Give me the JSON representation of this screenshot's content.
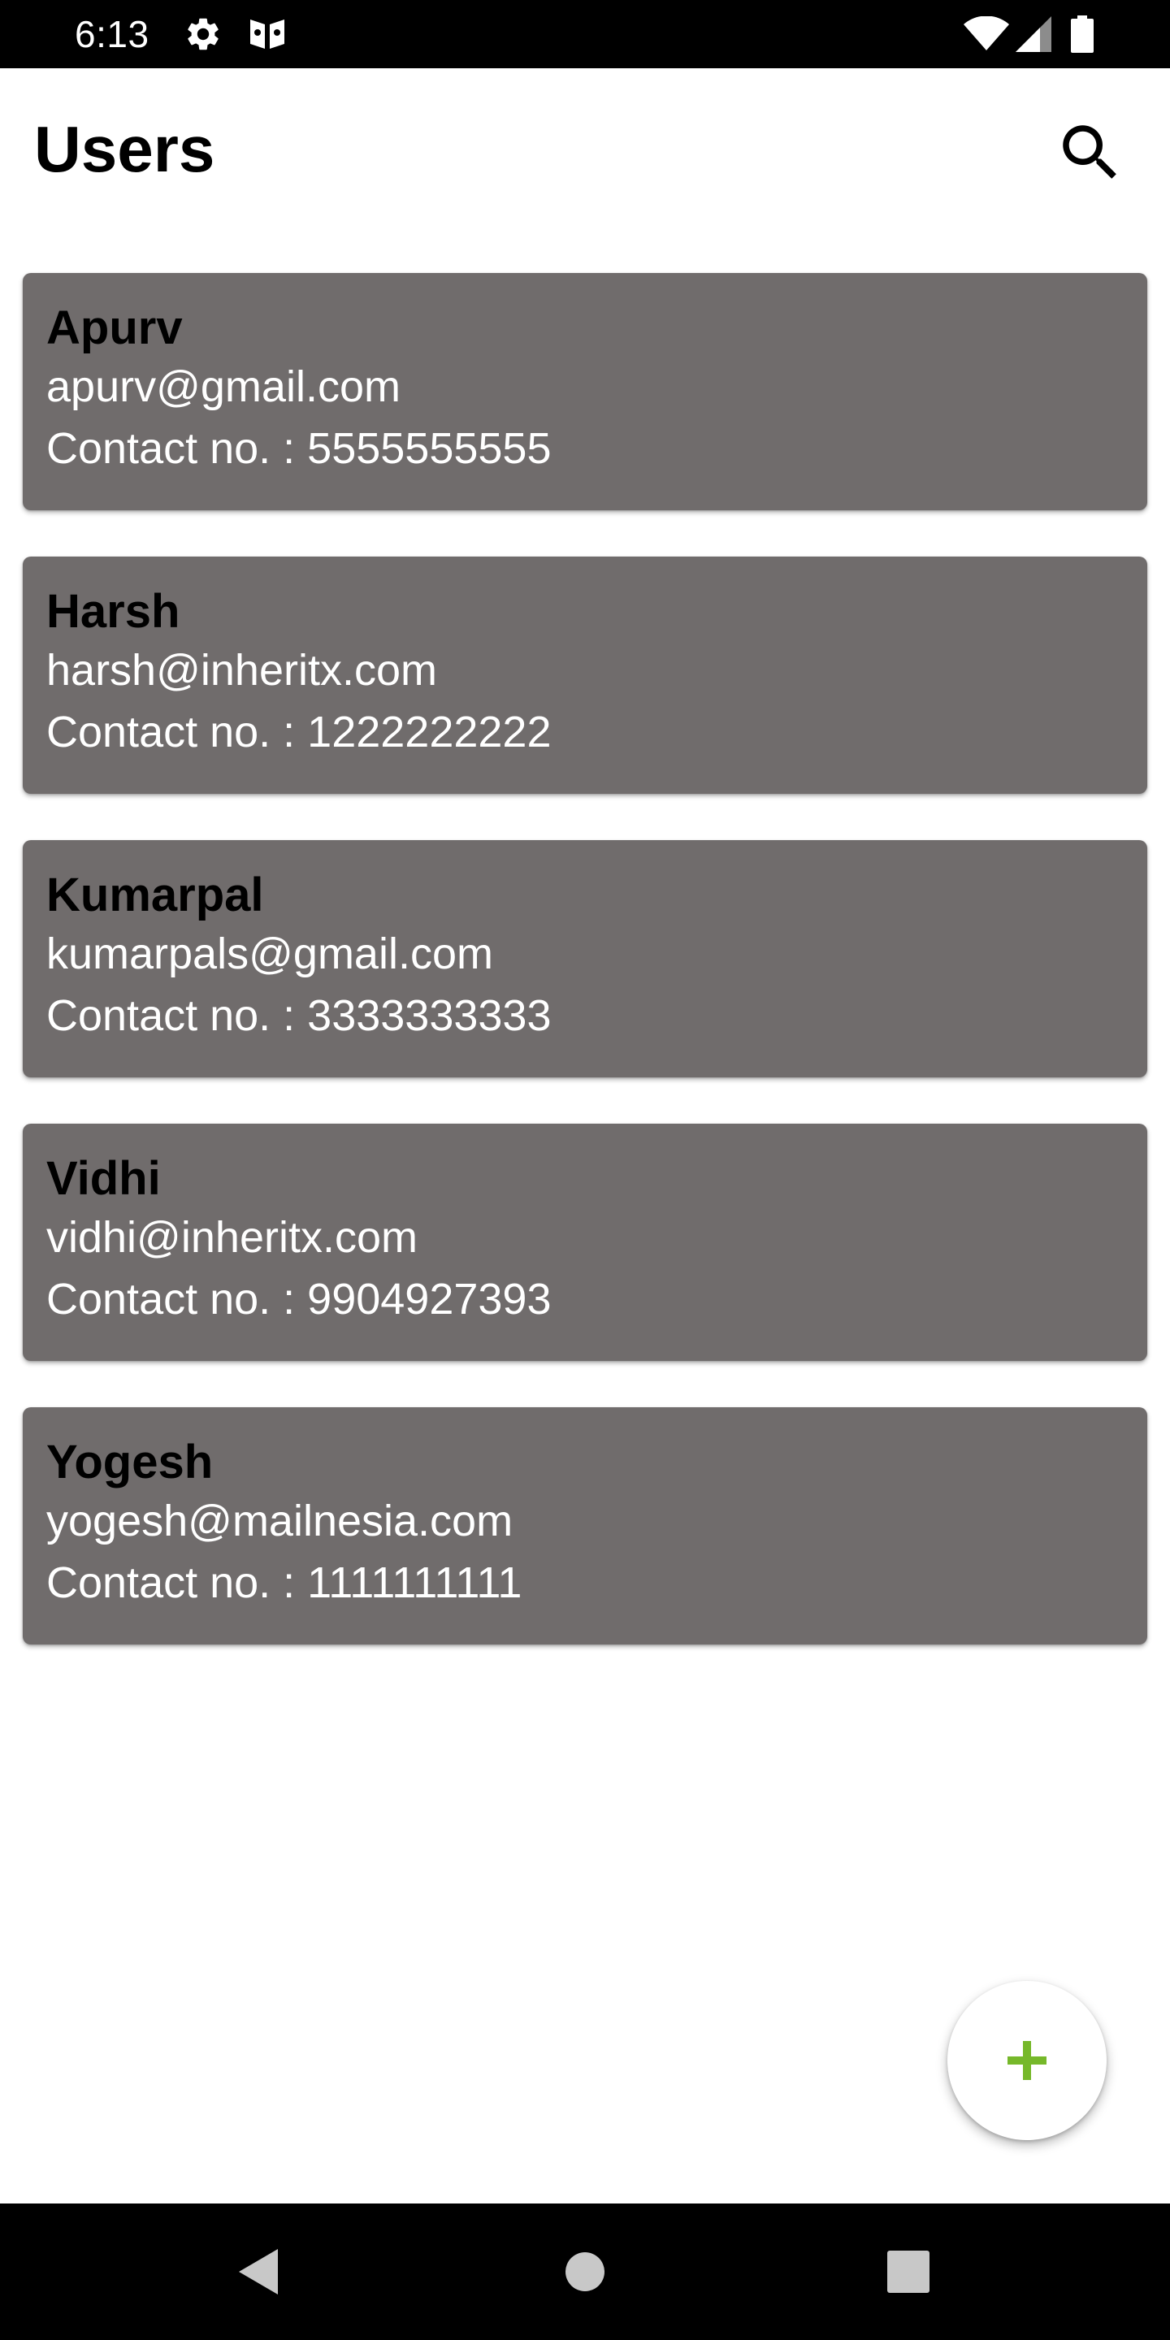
{
  "status_bar": {
    "time": "6:13",
    "icons": [
      "gear-icon",
      "notification-app-icon",
      "wifi-icon",
      "cellular-signal-icon",
      "battery-icon"
    ]
  },
  "app_bar": {
    "title": "Users",
    "search_icon": "search-icon"
  },
  "users": [
    {
      "name": "Apurv",
      "email": "apurv@gmail.com",
      "contact": "Contact no. : 5555555555"
    },
    {
      "name": "Harsh",
      "email": "harsh@inheritx.com",
      "contact": "Contact no. : 1222222222"
    },
    {
      "name": "Kumarpal",
      "email": "kumarpals@gmail.com",
      "contact": "Contact no. : 3333333333"
    },
    {
      "name": "Vidhi",
      "email": "vidhi@inheritx.com",
      "contact": "Contact no. : 9904927393"
    },
    {
      "name": "Yogesh",
      "email": "yogesh@mailnesia.com",
      "contact": "Contact no. : 1111111111"
    }
  ],
  "fab": {
    "icon": "plus-icon",
    "label": "+"
  },
  "nav_bar": {
    "icons": [
      "back-icon",
      "home-icon",
      "recents-icon"
    ]
  },
  "colors": {
    "card_background": "#706c6c",
    "card_name_text": "#000000",
    "card_detail_text": "#ffffff",
    "fab_icon": "#76b82a",
    "system_bars": "#000000",
    "background": "#ffffff"
  }
}
